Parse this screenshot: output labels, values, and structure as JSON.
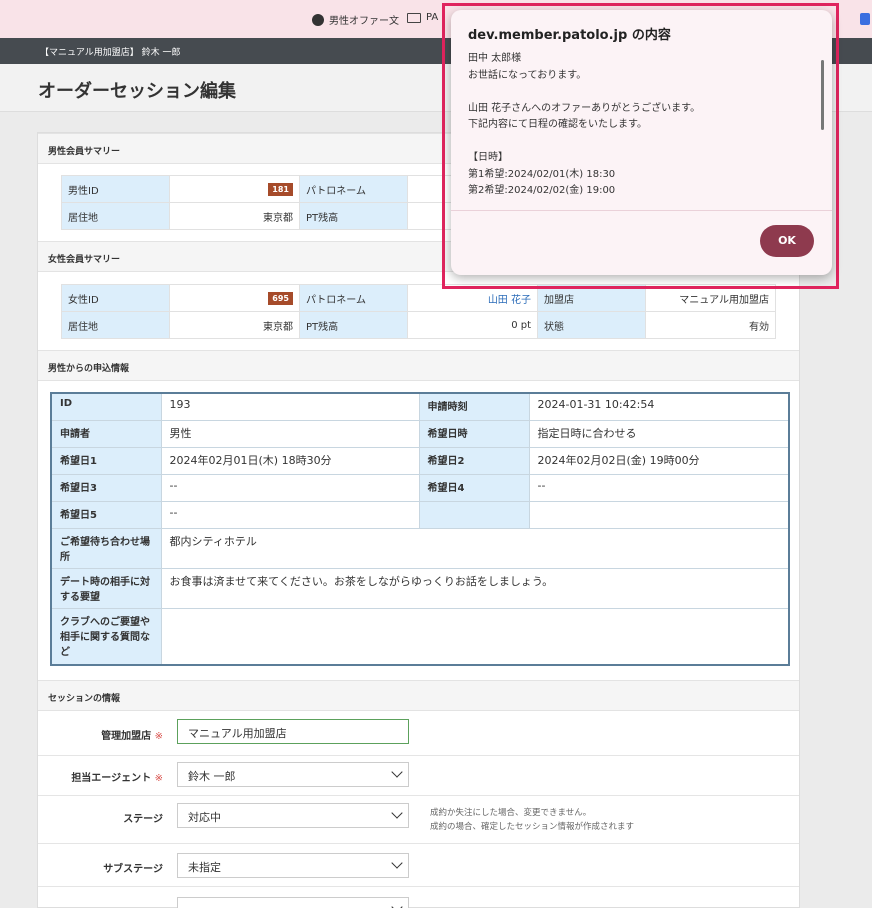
{
  "bookmarks": {
    "item1": "男性オファー文",
    "item2": "PA"
  },
  "topbar": {
    "text": "【マニュアル用加盟店】 鈴木 一郎"
  },
  "page": {
    "title": "オーダーセッション編集"
  },
  "male_summary": {
    "header": "男性会員サマリー",
    "id_label": "男性ID",
    "id_value": "181",
    "patoro_label": "パトロネーム",
    "residence_label": "居住地",
    "residence_value": "東京都",
    "pt_label": "PT残高"
  },
  "female_summary": {
    "header": "女性会員サマリー",
    "id_label": "女性ID",
    "id_value": "695",
    "patoro_label": "パトロネーム",
    "patoro_value": "山田 花子",
    "shop_label": "加盟店",
    "shop_value": "マニュアル用加盟店",
    "residence_label": "居住地",
    "residence_value": "東京都",
    "pt_label": "PT残高",
    "pt_value": "0 pt",
    "status_label": "状態",
    "status_value": "有効"
  },
  "application": {
    "header": "男性からの申込情報",
    "rows": {
      "id_label": "ID",
      "id_value": "193",
      "apply_time_label": "申請時刻",
      "apply_time_value": "2024-01-31 10:42:54",
      "applicant_label": "申請者",
      "applicant_value": "男性",
      "desired_time_label": "希望日時",
      "desired_time_value": "指定日時に合わせる",
      "date1_label": "希望日1",
      "date1_value": "2024年02月01日(木) 18時30分",
      "date2_label": "希望日2",
      "date2_value": "2024年02月02日(金) 19時00分",
      "date3_label": "希望日3",
      "date3_value": "--",
      "date4_label": "希望日4",
      "date4_value": "--",
      "date5_label": "希望日5",
      "date5_value": "--",
      "place_label": "ご希望待ち合わせ場所",
      "place_value": "都内シティホテル",
      "request_label": "デート時の相手に対する要望",
      "request_value": "お食事は済ませて来てください。お茶をしながらゆっくりお話をしましょう。",
      "club_label": "クラブへのご要望や相手に関する質問など",
      "club_value": ""
    }
  },
  "session": {
    "header": "セッションの情報",
    "shop_label": "管理加盟店",
    "shop_value": "マニュアル用加盟店",
    "agent_label": "担当エージェント",
    "agent_value": "鈴木 一郎",
    "stage_label": "ステージ",
    "stage_value": "対応中",
    "stage_help1": "成約か失注にした場合、変更できません。",
    "stage_help2": "成約の場合、確定したセッション情報が作成されます",
    "substage_label": "サブステージ",
    "substage_value": "未指定",
    "required_mark": "※"
  },
  "dialog": {
    "title": "dev.member.patolo.jp の内容",
    "lines": [
      "田中 太郎様",
      "お世話になっております。",
      "",
      "山田 花子さんへのオファーありがとうございます。",
      "下記内容にて日程の確認をいたします。",
      "",
      "【日時】",
      "第1希望:2024/02/01(木) 18:30",
      "第2希望:2024/02/02(金) 19:00"
    ],
    "ok_label": "OK"
  },
  "colors": {
    "accent": "#8e3a4e",
    "highlight_border": "#e0245e",
    "label_bg": "#dceefb"
  }
}
